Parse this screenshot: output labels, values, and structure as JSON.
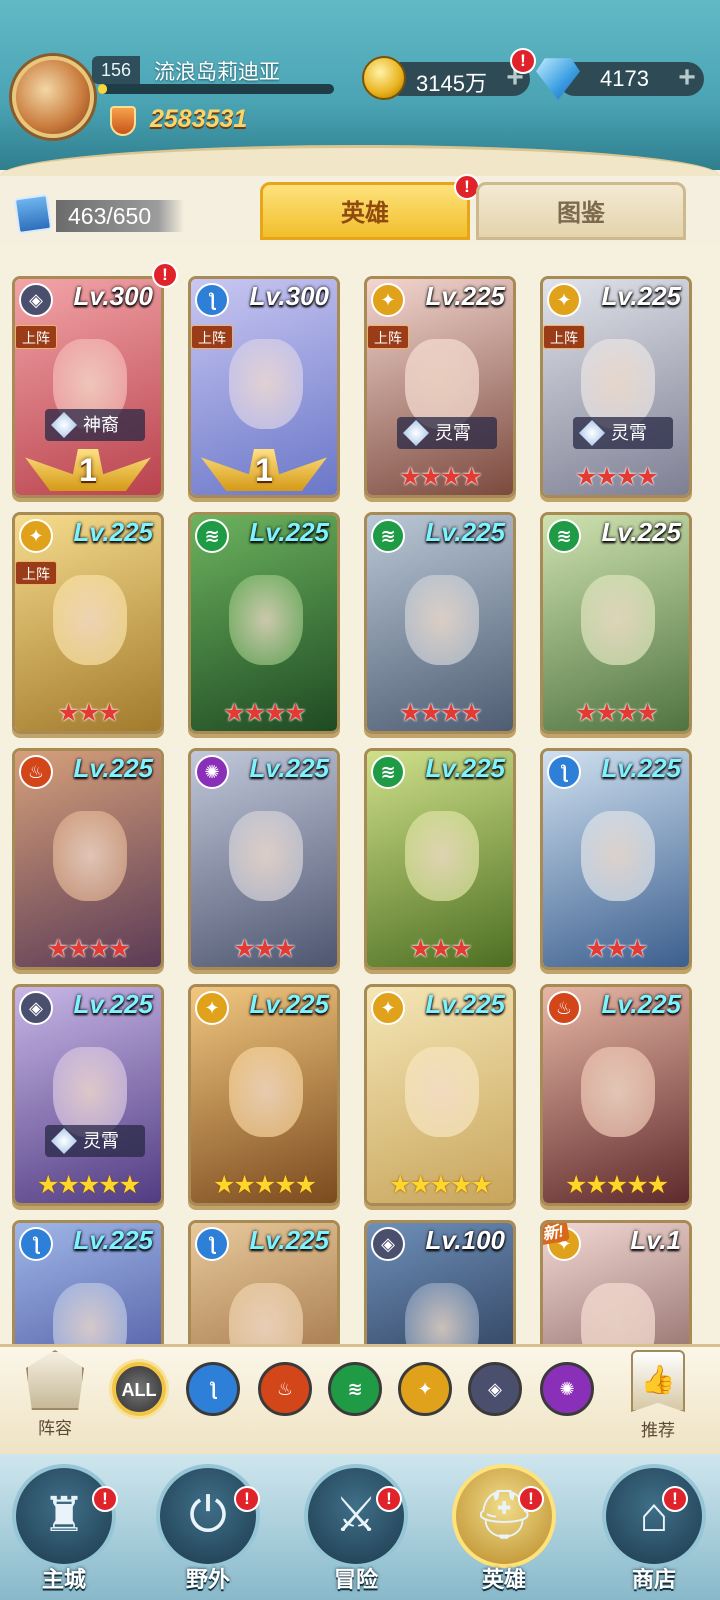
{
  "header": {
    "player_level": "156",
    "player_name": "流浪岛莉迪亚",
    "power": "2583531",
    "gold": "3145万",
    "diamonds": "4173",
    "plus": "+",
    "badge": "!"
  },
  "collection": {
    "count": "463/650"
  },
  "tabs": [
    {
      "label": "英雄"
    },
    {
      "label": "图鉴"
    }
  ],
  "heroes": [
    {
      "level": "Lv.300",
      "faction": "dark",
      "deployed": "上阵",
      "title": "神裔",
      "wings": "1",
      "badge": "!"
    },
    {
      "level": "Lv.300",
      "faction": "water",
      "deployed": "上阵",
      "wings": "1"
    },
    {
      "level": "Lv.225",
      "faction": "light",
      "deployed": "上阵",
      "title": "灵霄",
      "stars": "★★★★"
    },
    {
      "level": "Lv.225",
      "faction": "light",
      "deployed": "上阵",
      "title": "灵霄",
      "stars": "★★★★"
    },
    {
      "level": "Lv.225",
      "faction": "light",
      "deployed": "上阵",
      "stars": "★★★"
    },
    {
      "level": "Lv.225",
      "faction": "wind",
      "stars": "★★★★"
    },
    {
      "level": "Lv.225",
      "faction": "wind",
      "stars": "★★★★"
    },
    {
      "level": "Lv.225",
      "faction": "wind",
      "stars": "★★★★"
    },
    {
      "level": "Lv.225",
      "faction": "fire",
      "stars": "★★★★"
    },
    {
      "level": "Lv.225",
      "faction": "void",
      "stars": "★★★"
    },
    {
      "level": "Lv.225",
      "faction": "wind",
      "stars": "★★★"
    },
    {
      "level": "Lv.225",
      "faction": "water",
      "stars": "★★★"
    },
    {
      "level": "Lv.225",
      "faction": "dark",
      "title": "灵霄",
      "stars": "★★★★★"
    },
    {
      "level": "Lv.225",
      "faction": "light",
      "stars": "★★★★★"
    },
    {
      "level": "Lv.225",
      "faction": "light",
      "stars": "★★★★★"
    },
    {
      "level": "Lv.225",
      "faction": "fire",
      "stars": "★★★★★"
    },
    {
      "level": "Lv.225",
      "faction": "water"
    },
    {
      "level": "Lv.225",
      "faction": "water"
    },
    {
      "level": "Lv.100",
      "faction": "dark"
    },
    {
      "level": "Lv.1",
      "faction": "light",
      "new": "新!"
    }
  ],
  "filters": {
    "lineup_label": "阵容",
    "all_label": "ALL",
    "recommend_label": "推荐"
  },
  "nav": [
    {
      "label": "主城",
      "glyph": "♜"
    },
    {
      "label": "野外",
      "glyph": "⏻"
    },
    {
      "label": "冒险",
      "glyph": "⚔"
    },
    {
      "label": "英雄",
      "glyph": "⛑"
    },
    {
      "label": "商店",
      "glyph": "⌂"
    }
  ],
  "colors": {
    "water": "#2e7fd8",
    "fire": "#d2461a",
    "wind": "#1f9a45",
    "light": "#e1a21b",
    "dark": "#4b4f6e",
    "void": "#8a2fb8"
  }
}
